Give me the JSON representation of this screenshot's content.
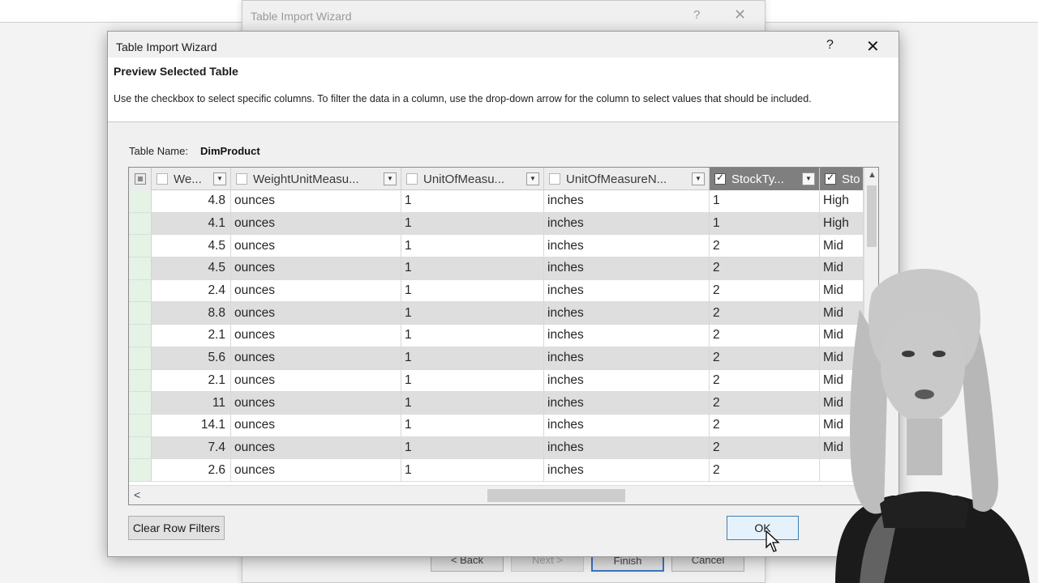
{
  "background_dialog": {
    "title": "Table Import Wizard",
    "help": "?",
    "close": "✕",
    "buttons": {
      "back": "< Back",
      "next": "Next >",
      "finish": "Finish",
      "cancel": "Cancel"
    }
  },
  "dialog": {
    "title": "Table Import Wizard",
    "help": "?",
    "close": "✕",
    "heading": "Preview Selected Table",
    "instructions": "Use the checkbox to select specific columns. To filter the data in a column, use the drop-down arrow  for the column to select values that should be included.",
    "table_name_label": "Table Name:",
    "table_name_value": "DimProduct",
    "columns": [
      {
        "label": "We...",
        "checked": false
      },
      {
        "label": "WeightUnitMeasu...",
        "checked": false
      },
      {
        "label": "UnitOfMeasu...",
        "checked": false
      },
      {
        "label": "UnitOfMeasureN...",
        "checked": false
      },
      {
        "label": "StockTy...",
        "checked": true
      },
      {
        "label": "Sto",
        "checked": true
      }
    ],
    "rows": [
      [
        "4.8",
        "ounces",
        "1",
        "inches",
        "1",
        "High"
      ],
      [
        "4.1",
        "ounces",
        "1",
        "inches",
        "1",
        "High"
      ],
      [
        "4.5",
        "ounces",
        "1",
        "inches",
        "2",
        "Mid"
      ],
      [
        "4.5",
        "ounces",
        "1",
        "inches",
        "2",
        "Mid"
      ],
      [
        "2.4",
        "ounces",
        "1",
        "inches",
        "2",
        "Mid"
      ],
      [
        "8.8",
        "ounces",
        "1",
        "inches",
        "2",
        "Mid"
      ],
      [
        "2.1",
        "ounces",
        "1",
        "inches",
        "2",
        "Mid"
      ],
      [
        "5.6",
        "ounces",
        "1",
        "inches",
        "2",
        "Mid"
      ],
      [
        "2.1",
        "ounces",
        "1",
        "inches",
        "2",
        "Mid"
      ],
      [
        "11",
        "ounces",
        "1",
        "inches",
        "2",
        "Mid"
      ],
      [
        "14.1",
        "ounces",
        "1",
        "inches",
        "2",
        "Mid"
      ],
      [
        "7.4",
        "ounces",
        "1",
        "inches",
        "2",
        "Mid"
      ],
      [
        "2.6",
        "ounces",
        "1",
        "inches",
        "2",
        ""
      ]
    ],
    "clear_filters_label": "Clear Row Filters",
    "ok_label": "OK"
  },
  "colors": {
    "dialog_bg": "#f0f0f0",
    "row_header": "#e4f3e6",
    "checked_header": "#7f7f7f",
    "ok_border": "#3c7fb1"
  }
}
